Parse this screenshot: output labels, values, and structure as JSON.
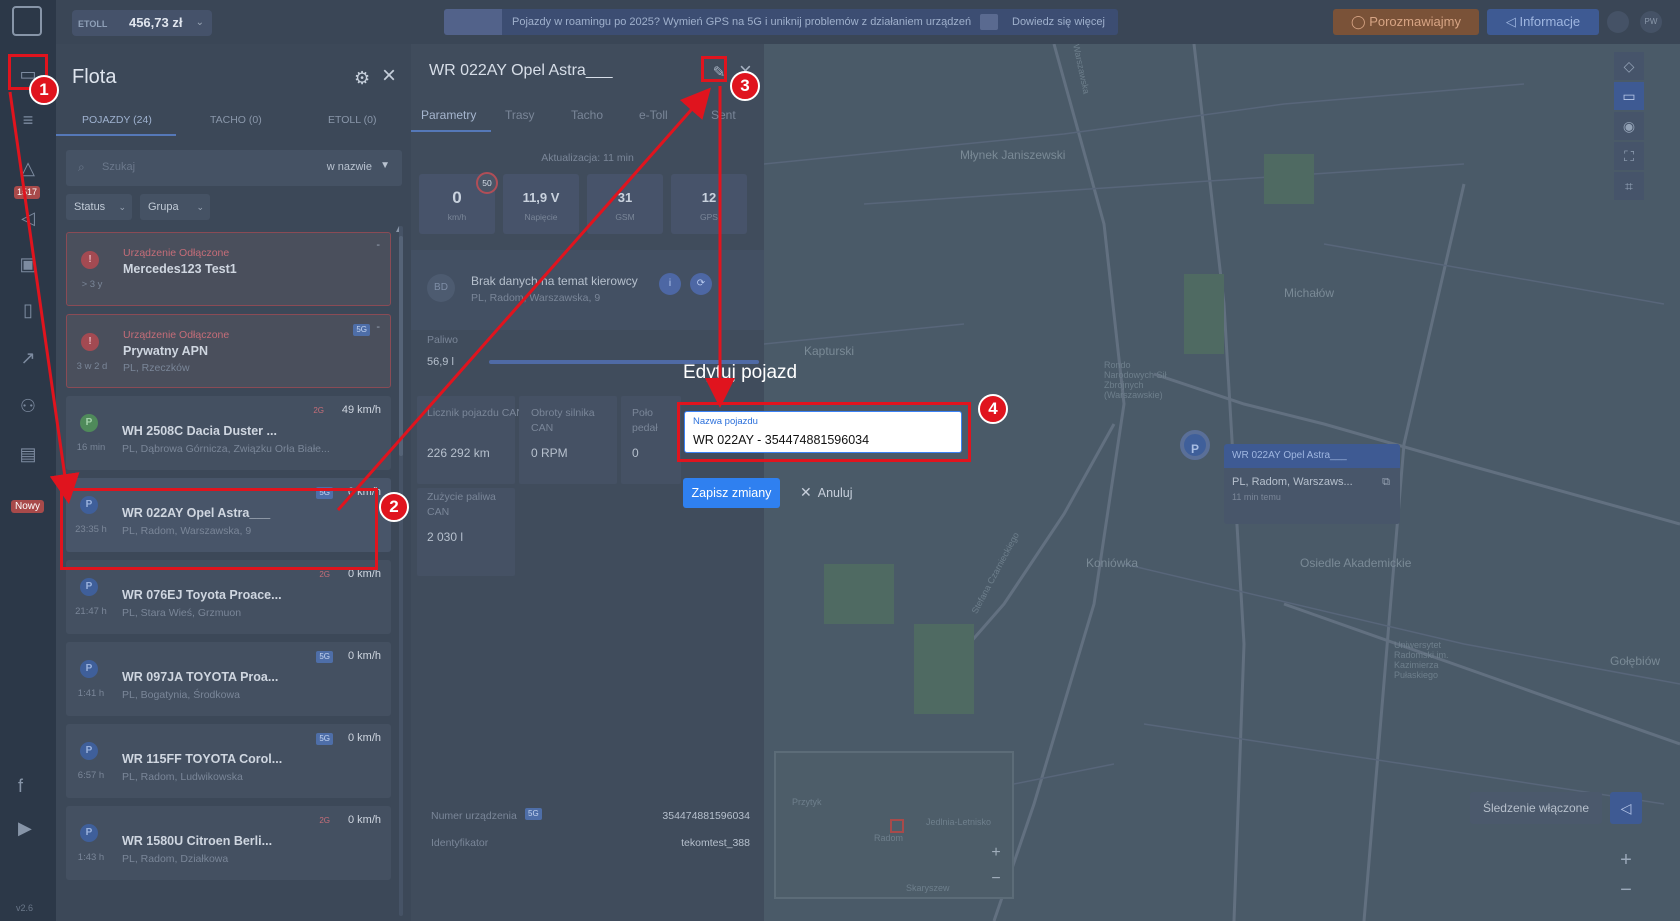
{
  "topbar": {
    "etoll_label": "ETOLL",
    "balance": "456,73 zł",
    "banner_text": "Pojazdy w roamingu po 2025? Wymień GPS na 5G i uniknij problemów z działaniem urządzeń",
    "banner_link": "Dowiedz się więcej",
    "chat_button": "Porozmawiajmy",
    "info_button": "Informacje",
    "user_initials": "PW"
  },
  "rail": {
    "alerts_badge": "1517",
    "new_badge": "Nowy",
    "version": "v2.6"
  },
  "fleet": {
    "title": "Flota",
    "tabs": [
      "POJAZDY (24)",
      "TACHO (0)",
      "ETOLL (0)"
    ],
    "search_placeholder": "Szukaj",
    "search_mode": "w nazwie",
    "filters": [
      "Status",
      "Grupa"
    ],
    "vehicles": [
      {
        "status": "Urządzenie Odłączone",
        "name": "Mercedes123 Test1",
        "location": "",
        "time": "> 3 y",
        "speed": "",
        "network": "",
        "dot": "!"
      },
      {
        "status": "Urządzenie Odłączone",
        "name": "Prywatny APN",
        "location": "PL, Rzeczków",
        "time": "3 w 2 d",
        "speed": "",
        "network": "5G",
        "dot": "!"
      },
      {
        "status": "",
        "name": "WH 2508C Dacia Duster ...",
        "location": "PL, Dąbrowa Górnicza, Związku Orła Białe...",
        "time": "16 min",
        "speed": "49 km/h",
        "network": "2G",
        "dot": "P"
      },
      {
        "status": "",
        "name": "WR 022AY Opel Astra___",
        "location": "PL, Radom, Warszawska, 9",
        "time": "23:35 h",
        "speed": "0 km/h",
        "network": "5G",
        "dot": "P"
      },
      {
        "status": "",
        "name": "WR 076EJ Toyota Proace...",
        "location": "PL, Stara Wieś, Grzmuon",
        "time": "21:47 h",
        "speed": "0 km/h",
        "network": "2G",
        "dot": "P"
      },
      {
        "status": "",
        "name": "WR 097JA TOYOTA Proa...",
        "location": "PL, Bogatynia, Środkowa",
        "time": "1:41 h",
        "speed": "0 km/h",
        "network": "5G",
        "dot": "P"
      },
      {
        "status": "",
        "name": "WR 115FF TOYOTA Corol...",
        "location": "PL, Radom, Ludwikowska",
        "time": "6:57 h",
        "speed": "0 km/h",
        "network": "5G",
        "dot": "P"
      },
      {
        "status": "",
        "name": "WR 1580U Citroen Berli...",
        "location": "PL, Radom, Działkowa",
        "time": "1:43 h",
        "speed": "0 km/h",
        "network": "2G",
        "dot": "P"
      }
    ]
  },
  "details": {
    "title": "WR 022AY Opel Astra___",
    "tabs": [
      "Parametry",
      "Trasy",
      "Tacho",
      "e-Toll",
      "Sent"
    ],
    "updated": "Aktualizacja: 11 min",
    "stats": [
      {
        "value": "0",
        "unit": "km/h"
      },
      {
        "value": "11,9 V",
        "unit": "Napięcie"
      },
      {
        "value": "31",
        "unit": "GSM"
      },
      {
        "value": "12",
        "unit": "GPS"
      }
    ],
    "speed_limit": "50",
    "driver_initials": "BD",
    "driver_name": "Brak danych na temat kierowcy",
    "driver_location": "PL, Radom, Warszawska, 9",
    "fuel_label": "Paliwo",
    "fuel_value": "56,9 l",
    "fuel_level_pct": 100,
    "counters": [
      {
        "label": "Licznik pojazdu CAN",
        "value": "226 292 km"
      },
      {
        "label": "Obroty silnika CAN",
        "value": "0 RPM"
      },
      {
        "label": "Poło pedał",
        "value": "0"
      },
      {
        "label": "Zużycie paliwa CAN",
        "value": "2 030 l"
      }
    ],
    "device_number_label": "Numer urządzenia",
    "device_number_network": "5G",
    "device_number": "354474881596034",
    "identifier_label": "Identyfikator",
    "identifier": "tekomtest_388"
  },
  "modal": {
    "title": "Edytuj pojazd",
    "field_label": "Nazwa pojazdu",
    "field_value": "WR 022AY - 354474881596034",
    "save_label": "Zapisz zmiany",
    "cancel_label": "Anuluj"
  },
  "map": {
    "labels": [
      "Młynek Janiszewski",
      "Michałów",
      "Kapturski",
      "Koniówka",
      "Osiedle Akademickie",
      "Gołębiów",
      "Rondo Narodowych Sił Zbrojnych (Warszawskie)",
      "Uniwersytet Radomski im. Kazimierza Pułaskiego",
      "Warszawska",
      "Stefana Czarnieckiego"
    ],
    "popup_title": "WR 022AY Opel Astra___",
    "popup_location": "PL, Radom, Warszaws...",
    "popup_ago": "11 min temu",
    "minimap_labels": [
      "Przytyk",
      "Radom",
      "Jedlnia-Letnisko",
      "Skaryszew"
    ],
    "tracking_label": "Śledzenie włączone"
  },
  "annotations": [
    "1",
    "2",
    "3",
    "4"
  ],
  "colors": {
    "annotation": "#e0141e",
    "primary": "#2f80f0"
  }
}
